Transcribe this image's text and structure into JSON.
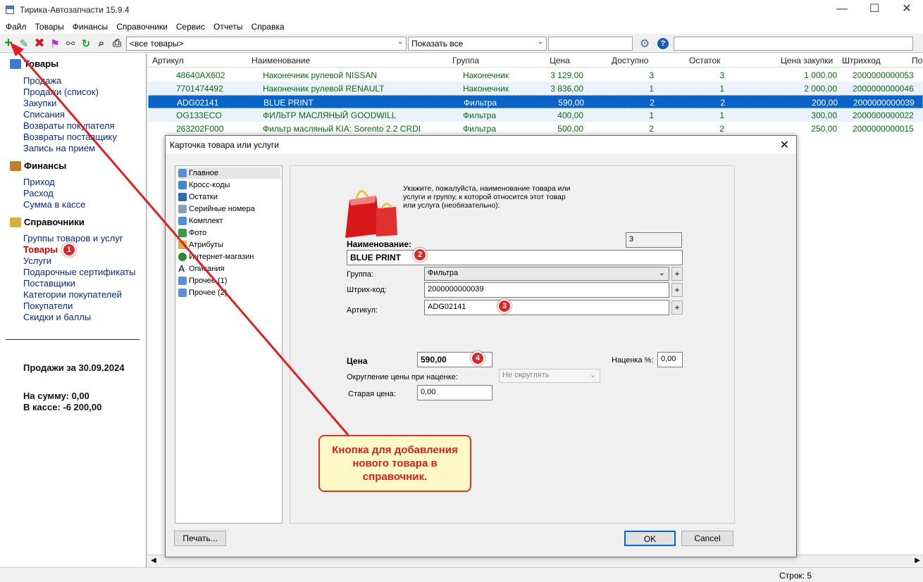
{
  "window": {
    "title": "Тирика-Автозапчасти 15.9.4",
    "controls": [
      "—",
      "☐",
      "✕"
    ]
  },
  "menu": [
    "Файл",
    "Товары",
    "Финансы",
    "Справочники",
    "Сервис",
    "Отчеты",
    "Справка"
  ],
  "toolbar": {
    "filter_group": "<все товары>",
    "filter_show": "Показать все",
    "search_value": ""
  },
  "sidebar": {
    "sections": [
      {
        "title": "Товары",
        "items": [
          "Продажа",
          "Продажи (список)",
          "Закупки",
          "Списания",
          "Возвраты покупателя",
          "Возвраты поставщику",
          "Запись на прием"
        ]
      },
      {
        "title": "Финансы",
        "items": [
          "Приход",
          "Расход",
          "Сумма в кассе"
        ]
      },
      {
        "title": "Справочники",
        "items": [
          "Группы товаров и услуг",
          "Товары",
          "Услуги",
          "Подарочные сертификаты",
          "Поставщики",
          "Категории покупателей",
          "Покупатели",
          "Скидки и баллы"
        ]
      }
    ],
    "sales_title": "Продажи за 30.09.2024",
    "sales_sum": "На сумму: 0,00",
    "cash": "В кассе: -6 200,00"
  },
  "grid": {
    "columns": [
      "Артикул",
      "Наименование",
      "Группа",
      "Цена",
      "Доступно",
      "Остаток",
      "Цена закупки",
      "Штрихкод",
      "По"
    ],
    "rows": [
      [
        "48640AX602",
        "Наконечник рулевой NISSAN",
        "Наконечник",
        "3 129,00",
        "3",
        "3",
        "1 000,00",
        "2000000000053"
      ],
      [
        "7701474492",
        "Наконечник рулевой RENAULT",
        "Наконечник",
        "3 836,00",
        "1",
        "1",
        "2 000,00",
        "2000000000046"
      ],
      [
        "ADG02141",
        "BLUE PRINT",
        "Фильтра",
        "590,00",
        "2",
        "2",
        "200,00",
        "2000000000039"
      ],
      [
        "OG133ECO",
        "ФИЛЬТР МАСЛЯНЫЙ GOODWILL",
        "Фильтра",
        "400,00",
        "1",
        "1",
        "300,00",
        "2000000000022"
      ],
      [
        "263202F000",
        "Фильтр масляный KIA: Sorento 2.2 CRDI",
        "Фильтра",
        "500,00",
        "2",
        "2",
        "250,00",
        "2000000000015"
      ]
    ]
  },
  "status": {
    "rows": "Строк: 5"
  },
  "dialog": {
    "title": "Карточка товара или услуги",
    "nav": [
      "Главное",
      "Кросс-коды",
      "Остатки",
      "Серийные номера",
      "Комплект",
      "Фото",
      "Атрибуты",
      "Интернет-магазин",
      "Описания",
      "Прочее (1)",
      "Прочее (2)"
    ],
    "hint": "Укажите, пожалуйста, наименование товара или услуги и группу, к которой относится этот товар или услуга (необязательно):",
    "id_value": "3",
    "name_label": "Наименование:",
    "name_value": "BLUE PRINT",
    "group_label": "Группа:",
    "group_value": "Фильтра",
    "barcode_label": "Штрих-код:",
    "barcode_value": "2000000000039",
    "article_label": "Артикул:",
    "article_value": "ADG02141",
    "price_label": "Цена",
    "price_value": "590,00",
    "markup_label": "Наценка %:",
    "markup_value": "0,00",
    "rounding_label": "Округление цены при наценке:",
    "rounding_value": "Не округлять",
    "old_price_label": "Старая цена:",
    "old_price_value": "0,00",
    "print_button": "Печать...",
    "ok_button": "OK",
    "cancel_button": "Cancel"
  },
  "annotations": {
    "callout": "Кнопка для добавления нового товара в справочник.",
    "badges": [
      "1",
      "2",
      "3",
      "4"
    ],
    "accent": "#e02020"
  }
}
